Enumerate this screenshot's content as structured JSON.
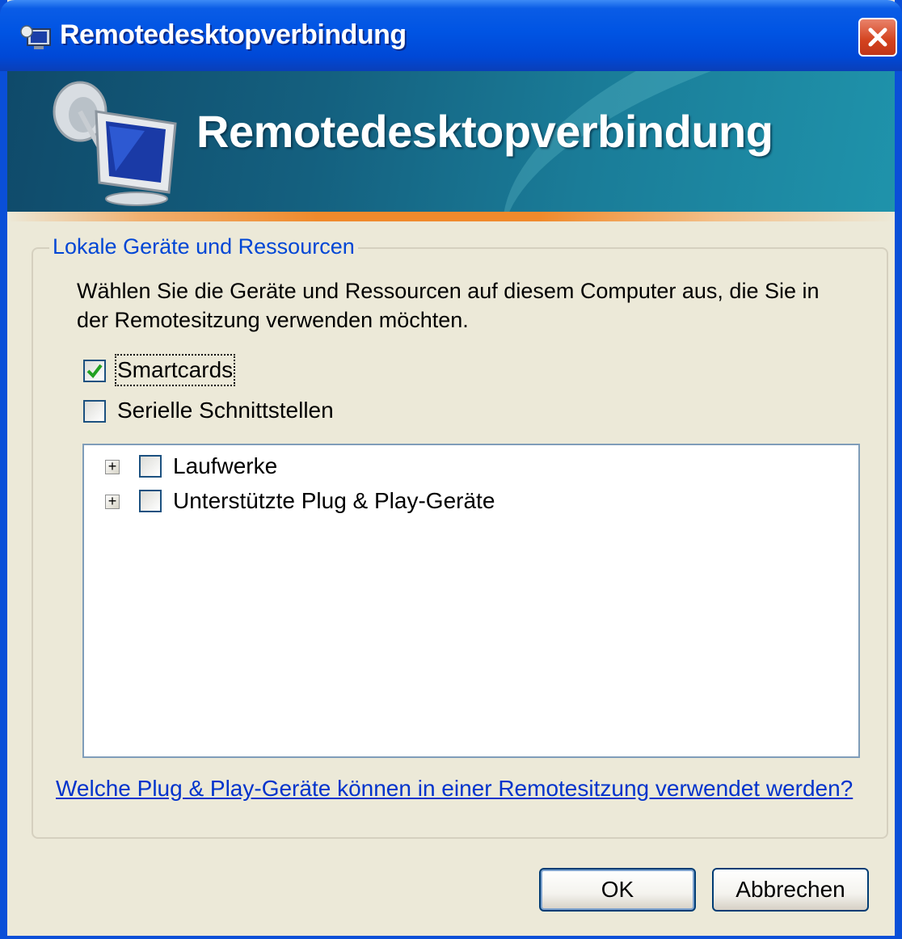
{
  "window": {
    "title": "Remotedesktopverbindung",
    "accent": "#0054e3"
  },
  "banner": {
    "title": "Remotedesktopverbindung"
  },
  "group": {
    "legend": "Lokale Geräte und Ressourcen",
    "description": "Wählen Sie die Geräte und Ressourcen auf diesem Computer aus, die Sie in der Remotesitzung verwenden möchten."
  },
  "options": [
    {
      "label": "Smartcards",
      "checked": true,
      "focused": true
    },
    {
      "label": "Serielle Schnittstellen",
      "checked": false,
      "focused": false
    }
  ],
  "tree": [
    {
      "label": "Laufwerke",
      "expander": "+",
      "checked": false
    },
    {
      "label": "Unterstützte Plug & Play-Geräte",
      "expander": "+",
      "checked": false
    }
  ],
  "help_link": "Welche Plug & Play-Geräte können in einer Remotesitzung verwendet werden?",
  "buttons": {
    "ok": "OK",
    "cancel": "Abbrechen"
  },
  "icons": {
    "title": "remote-desktop-icon",
    "close": "close-icon",
    "banner": "remote-desktop-logo-icon"
  }
}
